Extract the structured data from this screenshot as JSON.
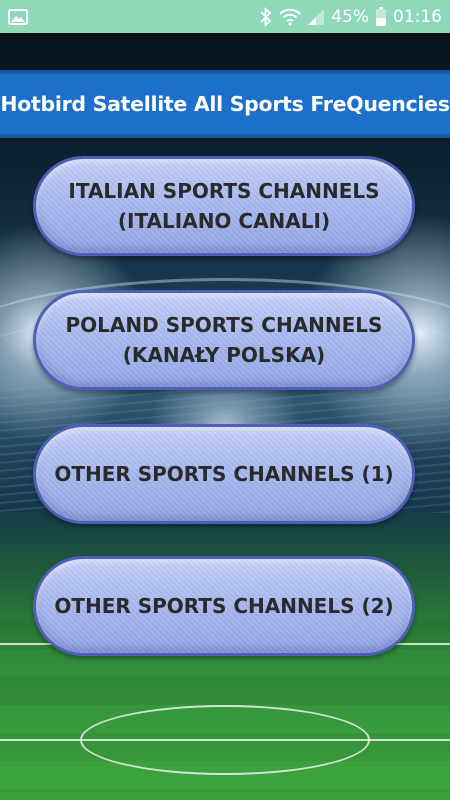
{
  "status_bar": {
    "battery_text": "45%",
    "time": "01:16",
    "icons": [
      "image-icon",
      "bluetooth-icon",
      "wifi-icon",
      "signal-icon",
      "battery-icon"
    ],
    "background_color": "#8fd8b8"
  },
  "header": {
    "title": "Hotbird Satellite All Sports FreQuencies",
    "background_color": "#1c6fcb"
  },
  "menu": {
    "italian_label": "ITALIAN SPORTS CHANNELS\n(ITALIANO CANALI)",
    "poland_label": "POLAND SPORTS CHANNELS\n(KANAŁY POLSKA)",
    "other1_label": "OTHER SPORTS CHANNELS (1)",
    "other2_label": "OTHER SPORTS CHANNELS (2)",
    "button_color": "#a6b7ef",
    "button_border_color": "#4f5fb6"
  }
}
